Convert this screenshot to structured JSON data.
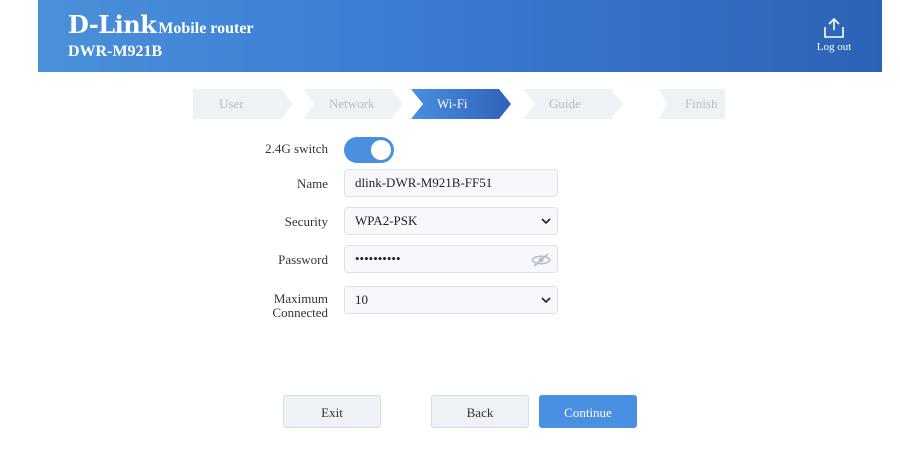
{
  "header": {
    "logo": "D-Link",
    "product": "Mobile router",
    "model": "DWR-M921B",
    "logout_label": "Log out"
  },
  "steps": [
    "User",
    "Network",
    "Wi-Fi",
    "Guide",
    "Finish"
  ],
  "active_step": "Wi-Fi",
  "form": {
    "switch_label": "2.4G switch",
    "switch_on": true,
    "name_label": "Name",
    "name_value": "dlink-DWR-M921B-FF51",
    "security_label": "Security",
    "security_value": "WPA2-PSK",
    "password_label": "Password",
    "password_value": "••••••••••",
    "max_label_line1": "Maximum",
    "max_label_line2": "Connected",
    "max_value": "10"
  },
  "buttons": {
    "exit": "Exit",
    "back": "Back",
    "continue": "Continue"
  },
  "colors": {
    "accent": "#4a90e2",
    "header_gradient_start": "#4a90d9",
    "header_gradient_end": "#2d63b6"
  }
}
